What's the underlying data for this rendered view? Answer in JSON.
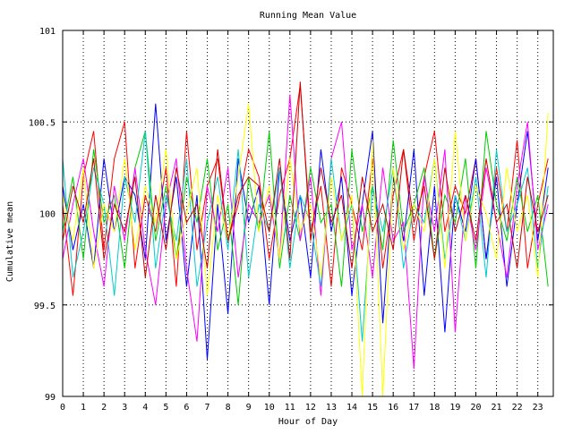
{
  "chart_data": {
    "type": "line",
    "title": "Running Mean Value",
    "xlabel": "Hour of Day",
    "ylabel": "Cumulative mean",
    "xlim": [
      0,
      23.75
    ],
    "ylim": [
      99,
      101
    ],
    "x_ticks": [
      "0",
      "1",
      "2",
      "3",
      "4",
      "5",
      "6",
      "7",
      "8",
      "9",
      "10",
      "11",
      "12",
      "13",
      "14",
      "15",
      "16",
      "17",
      "18",
      "19",
      "20",
      "21",
      "22",
      "23"
    ],
    "y_ticks": [
      "99",
      "99.5",
      "100",
      "100.5",
      "101"
    ],
    "grid": true,
    "x": [
      0,
      0.5,
      1,
      1.5,
      2,
      2.5,
      3,
      3.5,
      4,
      4.5,
      5,
      5.5,
      6,
      6.5,
      7,
      7.5,
      8,
      8.5,
      9,
      9.5,
      10,
      10.5,
      11,
      11.5,
      12,
      12.5,
      13,
      13.5,
      14,
      14.5,
      15,
      15.5,
      16,
      16.5,
      17,
      17.5,
      18,
      18.5,
      19,
      19.5,
      20,
      20.5,
      21,
      21.5,
      22,
      22.5,
      23,
      23.5
    ],
    "series": [
      {
        "color": "#ff0000",
        "values": [
          100.05,
          99.55,
          100.2,
          100.45,
          99.8,
          100.3,
          100.5,
          99.7,
          100.1,
          99.9,
          100.25,
          99.6,
          100.45,
          99.8,
          100.15,
          100.3,
          99.85,
          100.05,
          100.35,
          100.2,
          99.75,
          100.1,
          100.3,
          100.7,
          99.9,
          100.15,
          99.6,
          100.25,
          100.05,
          99.8,
          100.3,
          99.7,
          100.1,
          100.35,
          99.85,
          100.2,
          100.45,
          99.9,
          100.15,
          100.0,
          100.3,
          99.75,
          100.25,
          99.9,
          100.4,
          99.7,
          100.05,
          100.3
        ]
      },
      {
        "color": "#0000ff",
        "values": [
          100.15,
          99.8,
          100.05,
          99.7,
          100.3,
          99.9,
          100.2,
          100.1,
          99.75,
          100.6,
          99.85,
          100.2,
          99.6,
          100.1,
          99.2,
          100.05,
          99.45,
          100.3,
          99.95,
          100.15,
          99.5,
          100.25,
          99.85,
          100.1,
          99.65,
          100.35,
          99.9,
          100.2,
          99.55,
          100.05,
          100.45,
          99.4,
          100.2,
          99.85,
          100.35,
          99.55,
          100.15,
          99.35,
          100.1,
          99.9,
          100.3,
          99.75,
          100.2,
          99.6,
          100.05,
          100.45,
          99.85,
          100.25
        ]
      },
      {
        "color": "#00cc00",
        "values": [
          99.9,
          100.2,
          99.75,
          100.35,
          99.95,
          100.1,
          99.7,
          100.25,
          100.45,
          99.85,
          100.15,
          99.75,
          100.2,
          99.95,
          100.3,
          99.8,
          100.05,
          99.5,
          100.2,
          99.9,
          100.45,
          99.7,
          100.1,
          99.85,
          100.25,
          99.95,
          100.05,
          99.6,
          100.35,
          99.9,
          100.15,
          99.8,
          100.4,
          99.9,
          100.05,
          100.25,
          99.75,
          100.1,
          99.95,
          100.3,
          99.7,
          100.45,
          100.05,
          99.85,
          100.2,
          99.9,
          100.1,
          99.6
        ]
      },
      {
        "color": "#ff00ff",
        "values": [
          99.75,
          100.05,
          100.3,
          99.9,
          99.6,
          100.15,
          99.85,
          100.25,
          99.8,
          99.5,
          100.05,
          100.3,
          99.7,
          99.3,
          100.15,
          99.9,
          100.25,
          99.65,
          100.05,
          99.95,
          100.1,
          99.75,
          100.65,
          99.85,
          100.2,
          99.55,
          100.3,
          100.5,
          99.8,
          100.05,
          99.65,
          100.25,
          99.85,
          99.95,
          99.15,
          100.2,
          99.9,
          100.35,
          99.35,
          100.1,
          99.8,
          100.25,
          99.95,
          99.65,
          100.15,
          100.5,
          99.8,
          100.05
        ]
      },
      {
        "color": "#00cccc",
        "values": [
          100.3,
          99.65,
          99.9,
          100.25,
          100.05,
          99.55,
          100.2,
          99.95,
          100.45,
          99.7,
          100.1,
          99.85,
          100.3,
          99.6,
          99.95,
          100.2,
          99.8,
          100.35,
          99.65,
          100.05,
          99.9,
          100.25,
          99.7,
          100.1,
          99.95,
          99.6,
          100.3,
          99.85,
          100.05,
          99.3,
          100.15,
          99.9,
          100.25,
          99.7,
          100.05,
          99.95,
          100.3,
          99.75,
          100.1,
          99.85,
          100.2,
          99.65,
          100.35,
          99.9,
          100.05,
          100.25,
          99.7,
          100.15
        ]
      },
      {
        "color": "#ffff00",
        "values": [
          100.1,
          99.85,
          100.25,
          99.7,
          100.05,
          99.9,
          100.3,
          99.8,
          100.15,
          99.95,
          100.35,
          99.75,
          100.0,
          100.25,
          99.55,
          100.1,
          99.85,
          100.2,
          100.6,
          99.9,
          100.15,
          99.75,
          100.3,
          99.9,
          100.05,
          99.65,
          100.2,
          99.85,
          100.1,
          99.0,
          100.4,
          99.0,
          100.25,
          99.8,
          100.05,
          99.9,
          100.3,
          99.7,
          100.45,
          99.85,
          100.15,
          100.0,
          99.75,
          100.25,
          99.9,
          100.1,
          99.65,
          100.55
        ]
      },
      {
        "color": "#cc0000",
        "values": [
          99.85,
          100.15,
          99.95,
          100.3,
          99.75,
          100.05,
          99.9,
          100.2,
          99.65,
          100.1,
          99.8,
          100.25,
          99.95,
          100.05,
          99.7,
          100.35,
          99.85,
          100.1,
          100.2,
          100.15,
          99.9,
          100.3,
          99.75,
          100.72,
          99.85,
          100.25,
          99.95,
          100.1,
          99.7,
          100.2,
          99.9,
          100.05,
          99.8,
          100.35,
          99.95,
          100.15,
          99.75,
          100.25,
          99.9,
          100.1,
          99.85,
          100.3,
          99.95,
          100.05,
          99.7,
          100.2,
          99.9,
          100.1
        ]
      }
    ]
  }
}
